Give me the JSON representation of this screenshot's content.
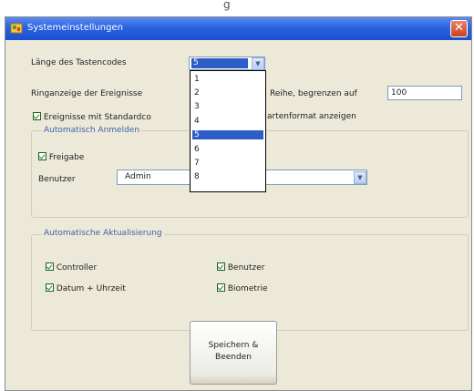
{
  "background": {
    "title_fragment": "g"
  },
  "window": {
    "title": "Systemeinstellungen",
    "close_glyph": "✕"
  },
  "code_length": {
    "label": "Länge des Tastencodes",
    "selected": "5",
    "options": [
      "1",
      "2",
      "3",
      "4",
      "5",
      "6",
      "7",
      "8"
    ]
  },
  "events_limit": {
    "label_left": "Ringanzeige der Ereignisse",
    "label_right": "Reihe, begrenzen auf",
    "value": "100"
  },
  "standard_format": {
    "label_left": "Ereignisse mit Standardco",
    "label_right": "artenformat anzeigen"
  },
  "auto_login": {
    "title": "Automatisch Anmelden",
    "release_label": "Freigabe",
    "user_label": "Benutzer",
    "user_value": "Admin"
  },
  "auto_update": {
    "title": "Automatische Aktualisierung",
    "items": {
      "controller": "Controller",
      "user": "Benutzer",
      "datetime": "Datum + Uhrzeit",
      "biometrics": "Biometrie"
    }
  },
  "save_button": {
    "line1": "Speichern &",
    "line2": "Beenden"
  },
  "colors": {
    "titlebar": "#2a62e0",
    "selection": "#2c5ec6",
    "window": "#ece9d8",
    "group_title": "#3f5fb0"
  }
}
